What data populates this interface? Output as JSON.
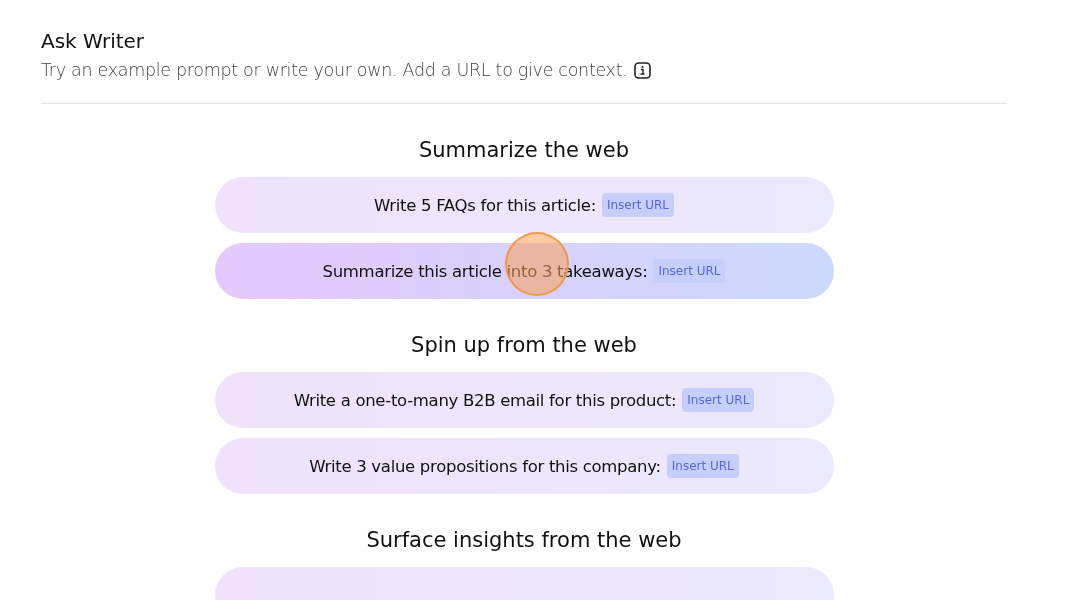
{
  "header": {
    "title": "Ask Writer",
    "subtitle": "Try an example prompt or write your own. Add a URL to give context."
  },
  "sections": [
    {
      "title": "Summarize the web",
      "prompts": [
        {
          "text": "Write 5 FAQs for this article:",
          "tag": "Insert URL",
          "highlighted": false
        },
        {
          "text": "Summarize this article into 3 takeaways:",
          "tag": "Insert URL",
          "highlighted": true
        }
      ]
    },
    {
      "title": "Spin up from the web",
      "prompts": [
        {
          "text": "Write a one-to-many B2B email for this product:",
          "tag": "Insert URL",
          "highlighted": false
        },
        {
          "text": "Write 3 value propositions for this company:",
          "tag": "Insert URL",
          "highlighted": false
        }
      ]
    },
    {
      "title": "Surface insights from the web",
      "prompts": [
        {
          "highlighted": false
        }
      ]
    }
  ]
}
